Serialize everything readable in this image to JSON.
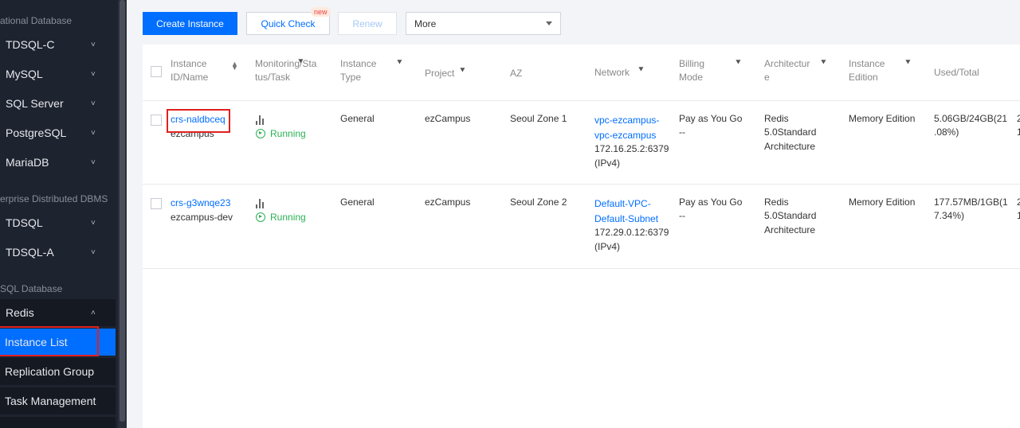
{
  "sidebar": {
    "sections": [
      "ational Database",
      "erprise Distributed DBMS",
      "SQL Database"
    ],
    "items": [
      {
        "label": "TDSQL-C",
        "chevron": "˅"
      },
      {
        "label": "MySQL",
        "chevron": "˅"
      },
      {
        "label": "SQL Server",
        "chevron": "˅"
      },
      {
        "label": "PostgreSQL",
        "chevron": "˅"
      },
      {
        "label": "MariaDB",
        "chevron": "˅"
      },
      {
        "label": "TDSQL",
        "chevron": "˅"
      },
      {
        "label": "TDSQL-A",
        "chevron": "˅"
      },
      {
        "label": "Redis",
        "chevron": "˄"
      }
    ],
    "subitems": [
      "Instance List",
      "Replication Group",
      "Task Management"
    ]
  },
  "toolbar": {
    "create": "Create Instance",
    "quick_check": "Quick Check",
    "new_tag": "new",
    "renew": "Renew",
    "more": "More"
  },
  "table": {
    "headers": {
      "id1": "Instance",
      "id2": "ID/Name",
      "mon1": "Monitoring/Sta",
      "mon2": "tus/Task",
      "type1": "Instance",
      "type2": "Type",
      "project": "Project",
      "az": "AZ",
      "network": "Network",
      "bill1": "Billing",
      "bill2": "Mode",
      "arch1": "Architectur",
      "arch2": "e",
      "ed1": "Instance",
      "ed2": "Edition",
      "used": "Used/Total"
    },
    "rows": [
      {
        "id": "crs-naldbceq",
        "name": "ezcampus",
        "status": "Running",
        "type": "General",
        "project": "ezCampus",
        "az": "Seoul Zone 1",
        "net1": "vpc-ezcampus-",
        "net2": "vpc-ezcampus",
        "ip": "172.16.25.2:6379",
        "ipv": "(IPv4)",
        "bill": "Pay as You Go",
        "bill2": "--",
        "arch1": "Redis",
        "arch2": "5.0Standard",
        "arch3": "Architecture",
        "edition": "Memory Edition",
        "used1": "5.06GB/24GB(21",
        "used2": ".08%)",
        "extra1": "2",
        "extra2": "1"
      },
      {
        "id": "crs-g3wnqe23",
        "name": "ezcampus-dev",
        "status": "Running",
        "type": "General",
        "project": "ezCampus",
        "az": "Seoul Zone 2",
        "net1": "Default-VPC-",
        "net2": "Default-Subnet",
        "ip": "172.29.0.12:6379",
        "ipv": "(IPv4)",
        "bill": "Pay as You Go",
        "bill2": "--",
        "arch1": "Redis",
        "arch2": "5.0Standard",
        "arch3": "Architecture",
        "edition": "Memory Edition",
        "used1": "177.57MB/1GB(1",
        "used2": "7.34%)",
        "extra1": "2",
        "extra2": "1"
      }
    ]
  }
}
